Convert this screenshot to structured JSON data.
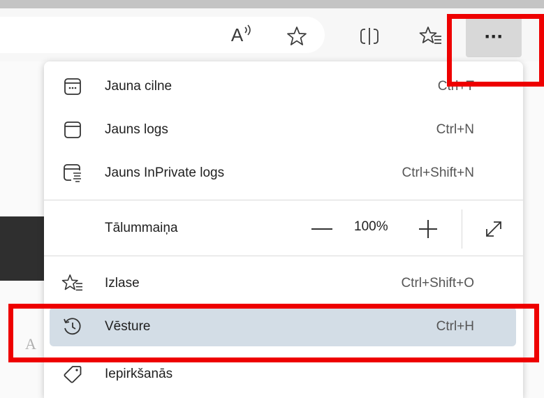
{
  "colors": {
    "highlight": "#ee0000",
    "active_row": "#d3dde6",
    "menu_bg": "#ffffff",
    "more_button_bg": "#d8d8d8"
  },
  "toolbar": {
    "read_aloud_label": "A",
    "icons": [
      "read-aloud-icon",
      "add-favorite-star-icon",
      "split-screen-icon",
      "favorites-icon",
      "more-ellipsis-icon"
    ],
    "more_label": "···"
  },
  "page_fragment_text": "A",
  "menu": {
    "items": [
      {
        "label": "Jauna cilne",
        "shortcut": "Ctrl+T",
        "icon": "new-tab-icon"
      },
      {
        "label": "Jauns logs",
        "shortcut": "Ctrl+N",
        "icon": "new-window-icon"
      },
      {
        "label": "Jauns InPrivate logs",
        "shortcut": "Ctrl+Shift+N",
        "icon": "inprivate-window-icon"
      }
    ],
    "zoom": {
      "label": "Tālummaiņa",
      "value": "100%",
      "minus": "—",
      "plus": "+"
    },
    "items2": [
      {
        "label": "Izlase",
        "shortcut": "Ctrl+Shift+O",
        "icon": "favorites-icon"
      },
      {
        "label": "Vēsture",
        "shortcut": "Ctrl+H",
        "icon": "history-icon",
        "active": true
      },
      {
        "label": "Iepirkšanās",
        "shortcut": "",
        "icon": "shopping-tag-icon"
      }
    ]
  }
}
